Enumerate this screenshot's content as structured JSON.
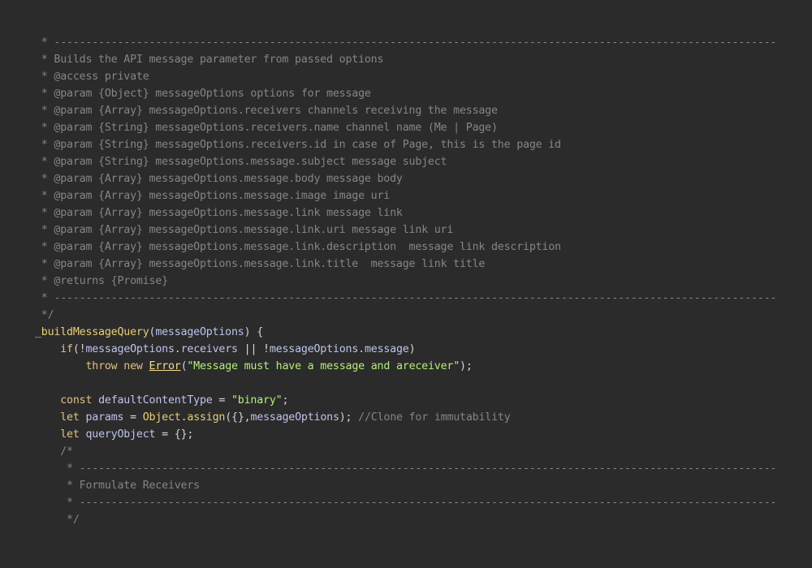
{
  "editor": {
    "background": "#2b2b2b",
    "colors": {
      "comment": "#858585",
      "keyword": "#e2c07f",
      "function": "#e7ce78",
      "identifier": "#bfc3ec",
      "string": "#b2ee79",
      "class": "#f1d98e"
    },
    "lines": [
      [
        {
          "t": "comment",
          "v": " * ------------------------------------------------------------------------------------------------------------------"
        }
      ],
      [
        {
          "t": "comment",
          "v": " * Builds the API message parameter from passed options"
        }
      ],
      [
        {
          "t": "comment",
          "v": " * @access private"
        }
      ],
      [
        {
          "t": "comment",
          "v": " * @param {Object} messageOptions options for message"
        }
      ],
      [
        {
          "t": "comment",
          "v": " * @param {Array} messageOptions.receivers channels receiving the message"
        }
      ],
      [
        {
          "t": "comment",
          "v": " * @param {String} messageOptions.receivers.name channel name (Me | Page)"
        }
      ],
      [
        {
          "t": "comment",
          "v": " * @param {String} messageOptions.receivers.id in case of Page, this is the page id"
        }
      ],
      [
        {
          "t": "comment",
          "v": " * @param {String} messageOptions.message.subject message subject"
        }
      ],
      [
        {
          "t": "comment",
          "v": " * @param {Array} messageOptions.message.body message body"
        }
      ],
      [
        {
          "t": "comment",
          "v": " * @param {Array} messageOptions.message.image image uri"
        }
      ],
      [
        {
          "t": "comment",
          "v": " * @param {Array} messageOptions.message.link message link"
        }
      ],
      [
        {
          "t": "comment",
          "v": " * @param {Array} messageOptions.message.link.uri message link uri"
        }
      ],
      [
        {
          "t": "comment",
          "v": " * @param {Array} messageOptions.message.link.description  message link description"
        }
      ],
      [
        {
          "t": "comment",
          "v": " * @param {Array} messageOptions.message.link.title  message link title"
        }
      ],
      [
        {
          "t": "comment",
          "v": " * @returns {Promise}"
        }
      ],
      [
        {
          "t": "comment",
          "v": " * ------------------------------------------------------------------------------------------------------------------"
        }
      ],
      [
        {
          "t": "comment",
          "v": " */"
        }
      ],
      [
        {
          "t": "func",
          "v": "_buildMessageQuery"
        },
        {
          "t": "punct",
          "v": "("
        },
        {
          "t": "var",
          "v": "messageOptions"
        },
        {
          "t": "punct",
          "v": ") {"
        }
      ],
      [
        {
          "t": "plain",
          "v": "    "
        },
        {
          "t": "keyword",
          "v": "if"
        },
        {
          "t": "punct",
          "v": "(!"
        },
        {
          "t": "var",
          "v": "messageOptions"
        },
        {
          "t": "punct",
          "v": "."
        },
        {
          "t": "prop",
          "v": "receivers"
        },
        {
          "t": "op",
          "v": " || !"
        },
        {
          "t": "var",
          "v": "messageOptions"
        },
        {
          "t": "punct",
          "v": "."
        },
        {
          "t": "prop",
          "v": "message"
        },
        {
          "t": "punct",
          "v": ")"
        }
      ],
      [
        {
          "t": "plain",
          "v": "        "
        },
        {
          "t": "keyword",
          "v": "throw"
        },
        {
          "t": "plain",
          "v": " "
        },
        {
          "t": "keyword",
          "v": "new"
        },
        {
          "t": "plain",
          "v": " "
        },
        {
          "t": "class",
          "v": "Error"
        },
        {
          "t": "punct",
          "v": "("
        },
        {
          "t": "string",
          "v": "\"Message must have a message and areceiver\""
        },
        {
          "t": "punct",
          "v": ");"
        }
      ],
      [
        {
          "t": "plain",
          "v": " "
        }
      ],
      [
        {
          "t": "plain",
          "v": "    "
        },
        {
          "t": "keyword",
          "v": "const"
        },
        {
          "t": "plain",
          "v": " "
        },
        {
          "t": "var",
          "v": "defaultContentType"
        },
        {
          "t": "op",
          "v": " = "
        },
        {
          "t": "string",
          "v": "\"binary\""
        },
        {
          "t": "punct",
          "v": ";"
        }
      ],
      [
        {
          "t": "plain",
          "v": "    "
        },
        {
          "t": "keyword",
          "v": "let"
        },
        {
          "t": "plain",
          "v": " "
        },
        {
          "t": "var",
          "v": "params"
        },
        {
          "t": "op",
          "v": " = "
        },
        {
          "t": "func",
          "v": "Object"
        },
        {
          "t": "punct",
          "v": "."
        },
        {
          "t": "func",
          "v": "assign"
        },
        {
          "t": "punct",
          "v": "({},"
        },
        {
          "t": "var",
          "v": "messageOptions"
        },
        {
          "t": "punct",
          "v": "); "
        },
        {
          "t": "comment",
          "v": "//Clone for immutability"
        }
      ],
      [
        {
          "t": "plain",
          "v": "    "
        },
        {
          "t": "keyword",
          "v": "let"
        },
        {
          "t": "plain",
          "v": " "
        },
        {
          "t": "var",
          "v": "queryObject"
        },
        {
          "t": "op",
          "v": " = "
        },
        {
          "t": "punct",
          "v": "{};"
        }
      ],
      [
        {
          "t": "comment",
          "v": "    /*"
        }
      ],
      [
        {
          "t": "comment",
          "v": "     * --------------------------------------------------------------------------------------------------------------"
        }
      ],
      [
        {
          "t": "comment",
          "v": "     * Formulate Receivers"
        }
      ],
      [
        {
          "t": "comment",
          "v": "     * --------------------------------------------------------------------------------------------------------------"
        }
      ],
      [
        {
          "t": "comment",
          "v": "     */"
        }
      ]
    ]
  }
}
